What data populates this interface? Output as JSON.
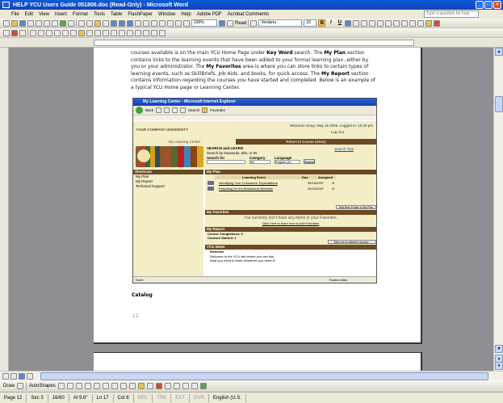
{
  "window": {
    "title": "HELP YCU Users Guide 051806.doc (Read-Only) - Microsoft Word"
  },
  "menu": {
    "items": [
      "File",
      "Edit",
      "View",
      "Insert",
      "Format",
      "Tools",
      "Table",
      "FlashPaper",
      "Window",
      "Help",
      "Adobe PDF",
      "Acrobat Comments"
    ],
    "ask_placeholder": "Type a question for help"
  },
  "toolbar": {
    "zoom": "100%",
    "read_label": "Read",
    "font": "Verdana",
    "size": "10",
    "bold": "B",
    "italic": "I",
    "underline": "U"
  },
  "document": {
    "para_html": [
      {
        "t": "courses available is on the main YCU Home Page under "
      },
      {
        "b": "Key Word"
      },
      {
        "t": " search. The "
      },
      {
        "b": "My Plan"
      },
      {
        "t": " section contains links to the learning events that have been added to your formal learning plan, either by you or your administrator. The "
      },
      {
        "b": "My Favorites"
      },
      {
        "t": " area is where you can store links to certain types of learning events, such as SkillBriefs, Job Aids, and books, for quick access. The "
      },
      {
        "b": "My Report"
      },
      {
        "t": " section contains information regarding the courses you have started and completed. Below is an example of a "
      },
      {
        "i": "typical"
      },
      {
        "t": " YCU Home page or Learning Center."
      }
    ],
    "catalog_heading": "Catalog",
    "page_number": "12"
  },
  "screenshot": {
    "ie_title": "My Learning Center - Microsoft Internet Explorer",
    "back": "Back",
    "search": "Search",
    "favorites": "Favorites",
    "university": "YOUR COMPANY UNIVERSITY",
    "welcome": "Welcome Doug.  May 15 2006, Logged In: 10:28 pm",
    "logout": "Log Out",
    "nav_left": "My Learning Center",
    "nav_right": "Return to Course Library",
    "search_learn": "SEARCH and LEARN",
    "search_hint": "Search by keywords, title, or ID",
    "search_for": "Search for",
    "category": "Category",
    "category_val": "All",
    "language": "Language",
    "language_val": "English (A)",
    "search_tips": "Search Tips",
    "go": "Search",
    "shortcuts": "Shortcuts",
    "shortcut_links": [
      "My Plan",
      "My Report",
      "Technical Support"
    ],
    "my_plan": "My Plan",
    "plan_cols": [
      "Learning Event",
      "Due",
      "Assigned"
    ],
    "plan_rows": [
      {
        "event": "Identifying Your Customers' Expectations",
        "date": "05/15/2007"
      },
      {
        "event": "Preparing for the Behavioral Interview",
        "date": "05/15/2007"
      }
    ],
    "plan_button": "Add New Folder to My Plan",
    "my_favorites": "My Favorites",
    "fav_empty": "You currently don't have any items in your Favorites.",
    "fav_add": "Click here to learn how to Add Favorites",
    "my_report": "My Report",
    "completions": "Course Completions: 0",
    "started": "Courses Started: 1",
    "report_button": "Take me to detailed reports...",
    "ycu_news": "YCU News",
    "news_title": "Welcome",
    "news_body": [
      "Welcome to the YCU site where you can find",
      "what you need to learn whenever you need it!"
    ],
    "status": "Done",
    "trusted": "Trusted sites"
  },
  "draw": {
    "draw_label": "Draw",
    "autoshapes_label": "AutoShapes"
  },
  "status": {
    "page": "Page 12",
    "sec": "Sec 3",
    "pages": "16/60",
    "at": "At 9.6\"",
    "ln": "Ln 17",
    "col": "Col 8",
    "modes": [
      "REC",
      "TRK",
      "EXT",
      "OVR"
    ],
    "lang": "English (U.S."
  }
}
